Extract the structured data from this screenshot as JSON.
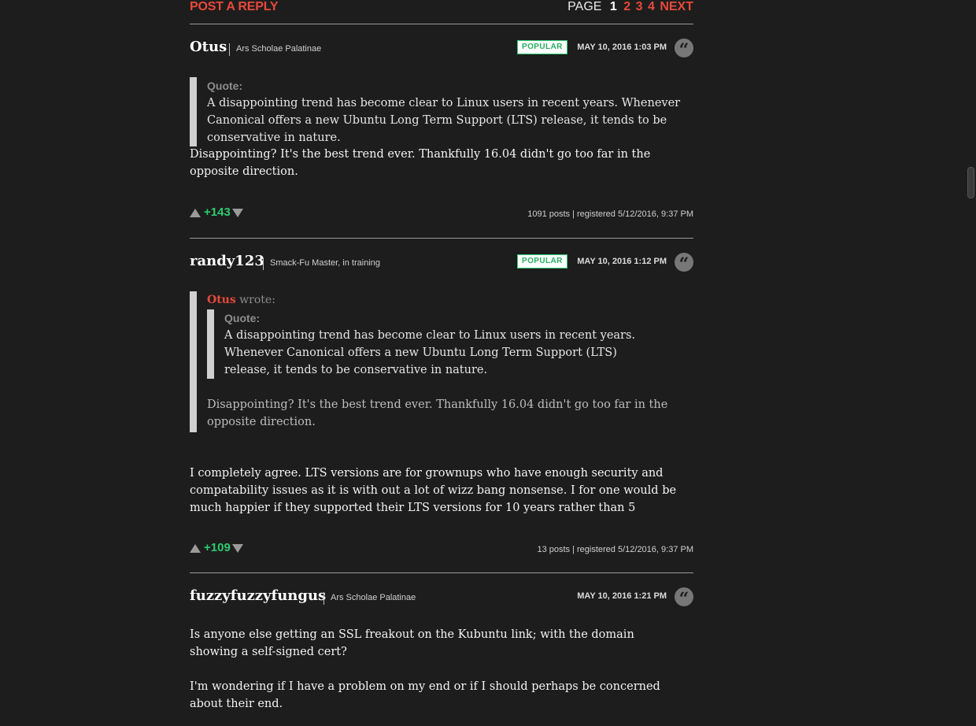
{
  "topbar": {
    "post_reply": "POST A REPLY",
    "page_label": "PAGE",
    "current_page": "1",
    "pages": [
      "2",
      "3",
      "4"
    ],
    "next": "NEXT"
  },
  "comments": [
    {
      "username": "Otus",
      "user_title": "Ars Scholae Palatinae",
      "badge": "POPULAR",
      "date": "MAY 10, 2016 1:03 PM",
      "quote_label": "Quote:",
      "quote_text": "A disappointing trend has become clear to Linux users in recent years. Whenever Canonical offers a new Ubuntu Long Term Support (LTS) release, it tends to be conservative in nature.",
      "body": "Disappointing? It's the best trend ever. Thankfully 16.04 didn't go too far in the opposite direction.",
      "score": "+143",
      "meta": "1091 posts | registered 5/12/2016, 9:37 PM"
    },
    {
      "username": "randy123",
      "user_title": "Smack-Fu Master, in training",
      "badge": "POPULAR",
      "date": "MAY 10, 2016 1:12 PM",
      "wrote_user": "Otus",
      "wrote_label": " wrote:",
      "inner_quote_label": "Quote:",
      "inner_quote_text": "A disappointing trend has become clear to Linux users in recent years. Whenever Canonical offers a new Ubuntu Long Term Support (LTS) release, it tends to be conservative in nature.",
      "quoted_body": "Disappointing? It's the best trend ever. Thankfully 16.04 didn't go too far in the opposite direction.",
      "body": "I completely agree. LTS versions are for grownups who have enough security and compatability issues as it is with out a lot of wizz bang nonsense. I for one would be much happier if they supported their LTS versions for 10 years rather than 5",
      "score": "+109",
      "meta": "13 posts | registered 5/12/2016, 9:37 PM"
    },
    {
      "username": "fuzzyfuzzyfungus",
      "user_title": "Ars Scholae Palatinae",
      "date": "MAY 10, 2016 1:21 PM",
      "body_p1": "Is anyone else getting an SSL freakout on the Kubuntu link; with the domain showing a self-signed cert?",
      "body_p2": "I'm wondering if I have a problem on my end or if I should perhaps be concerned about their end."
    }
  ],
  "icons": {
    "quote_button": "quote-icon",
    "upvote": "upvote-arrow-icon",
    "downvote": "downvote-arrow-icon"
  },
  "colors": {
    "accent": "#e8493a",
    "score": "#2ecc71",
    "background": "#1d1d1d"
  }
}
